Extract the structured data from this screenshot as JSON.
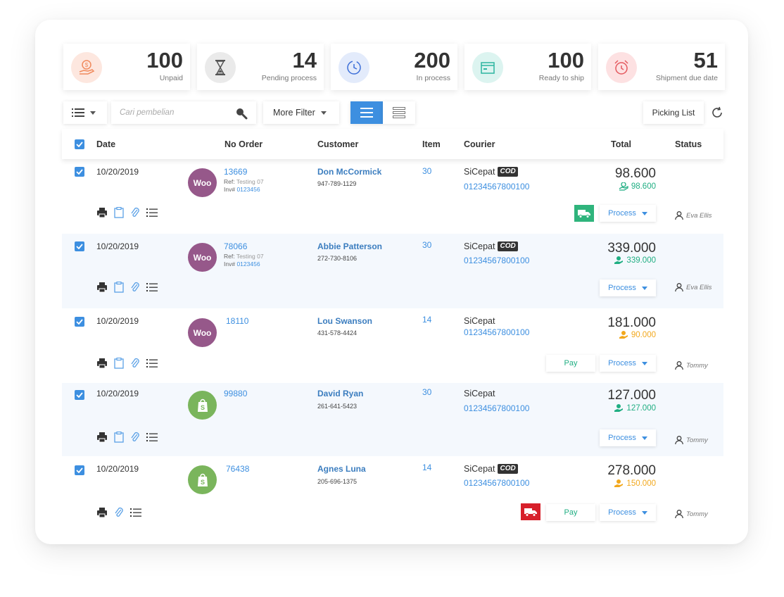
{
  "stats": [
    {
      "value": "100",
      "label": "Unpaid",
      "icon": "money-hand-icon",
      "color": "#f08a5d"
    },
    {
      "value": "14",
      "label": "Pending process",
      "icon": "hourglass-icon",
      "color": "#555555"
    },
    {
      "value": "200",
      "label": "In process",
      "icon": "clock-cycle-icon",
      "color": "#3d6fd8"
    },
    {
      "value": "100",
      "label": "Ready to ship",
      "icon": "box-icon",
      "color": "#2cb5a0"
    },
    {
      "value": "51",
      "label": "Shipment due date",
      "icon": "alarm-icon",
      "color": "#e4595f"
    }
  ],
  "toolbar": {
    "search_placeholder": "Cari pembelian",
    "filter_label": "More Filter",
    "picking_label": "Picking List"
  },
  "table": {
    "headers": {
      "date": "Date",
      "order": "No Order",
      "customer": "Customer",
      "item": "Item",
      "courier": "Courier",
      "total": "Total",
      "status": "Status"
    }
  },
  "rows": [
    {
      "date": "10/20/2019",
      "store": "woo",
      "order": "13669",
      "ref": "Testing 07",
      "inv": "0123456",
      "customer": "Don McCormick",
      "phone": "947-789-1129",
      "item": "30",
      "courier": "SiCepat",
      "cod": "COD",
      "tracking": "01234567800100",
      "total": "98.600",
      "paid": "98.600",
      "paid_color": "green",
      "process": "Process",
      "pay": "",
      "user": "Eva Ellis",
      "truck": "green"
    },
    {
      "date": "10/20/2019",
      "store": "woo",
      "order": "78066",
      "ref": "Testing 07",
      "inv": "0123456",
      "customer": "Abbie Patterson",
      "phone": "272-730-8106",
      "item": "30",
      "courier": "SiCepat",
      "cod": "COD",
      "tracking": "01234567800100",
      "total": "339.000",
      "paid": "339.000",
      "paid_color": "green",
      "process": "Process",
      "pay": "",
      "user": "Eva Ellis",
      "truck": ""
    },
    {
      "date": "10/20/2019",
      "store": "woo",
      "order": "18110",
      "ref": "",
      "inv": "",
      "customer": "Lou Swanson",
      "phone": "431-578-4424",
      "item": "14",
      "courier": "SiCepat",
      "cod": "",
      "tracking": "01234567800100",
      "total": "181.000",
      "paid": "90.000",
      "paid_color": "orange",
      "process": "Process",
      "pay": "Pay",
      "user": "Tommy",
      "truck": ""
    },
    {
      "date": "10/20/2019",
      "store": "shopify",
      "order": "99880",
      "ref": "",
      "inv": "",
      "customer": "David Ryan",
      "phone": "261-641-5423",
      "item": "30",
      "courier": "SiCepat",
      "cod": "",
      "tracking": "01234567800100",
      "total": "127.000",
      "paid": "127.000",
      "paid_color": "green",
      "process": "Process",
      "pay": "",
      "user": "Tommy",
      "truck": ""
    },
    {
      "date": "10/20/2019",
      "store": "shopify",
      "order": "76438",
      "ref": "",
      "inv": "",
      "customer": "Agnes Luna",
      "phone": "205-696-1375",
      "item": "14",
      "courier": "SiCepat",
      "cod": "COD",
      "tracking": "01234567800100",
      "total": "278.000",
      "paid": "150.000",
      "paid_color": "orange",
      "process": "Process",
      "pay": "Pay",
      "user": "Tommy",
      "truck": "red"
    }
  ],
  "labels": {
    "ref": "Ref:",
    "inv": "Inv#",
    "woo": "Woo"
  }
}
